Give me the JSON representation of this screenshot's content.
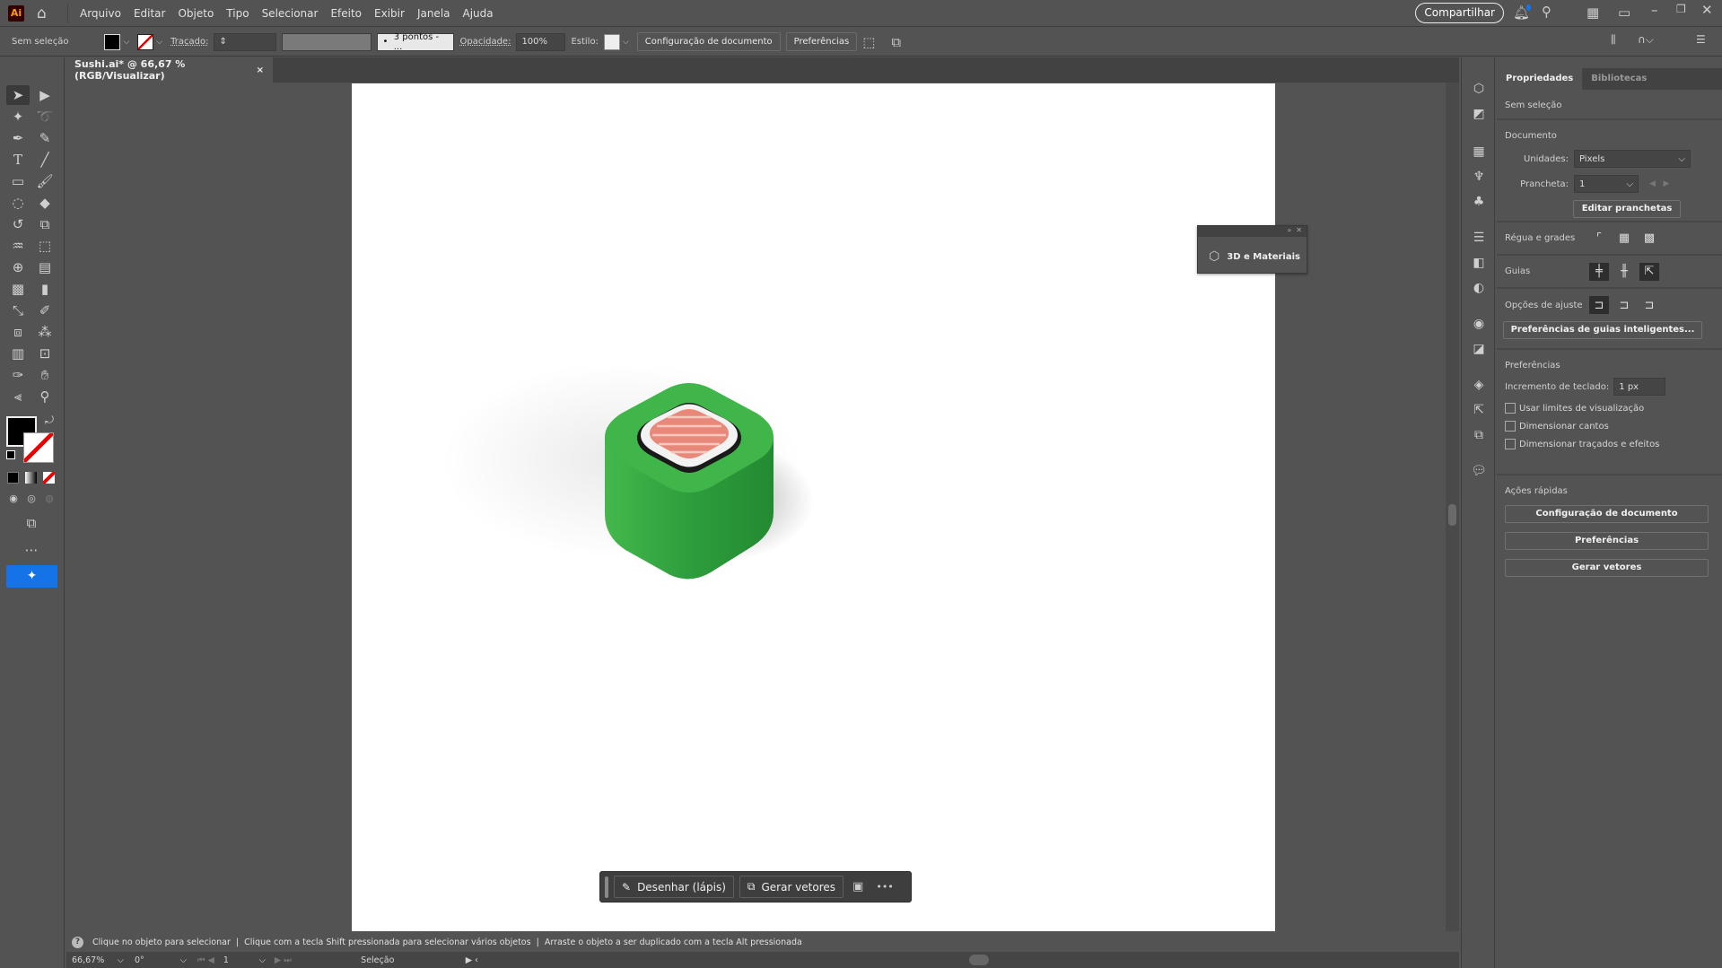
{
  "app": {
    "logo": "Ai",
    "menus": [
      "Arquivo",
      "Editar",
      "Objeto",
      "Tipo",
      "Selecionar",
      "Efeito",
      "Exibir",
      "Janela",
      "Ajuda"
    ],
    "share": "Compartilhar"
  },
  "control": {
    "selection": "Sem seleção",
    "stroke_label": "Traçado:",
    "brush": "3 pontos - ...",
    "opacity_label": "Opacidade:",
    "opacity": "100%",
    "style_label": "Estilo:",
    "doc_setup": "Configuração de documento",
    "prefs": "Preferências"
  },
  "tab": {
    "title": "Sushi.ai* @ 66,67 % (RGB/Visualizar)",
    "close": "×"
  },
  "panel3d": {
    "title": "3D e Materiais"
  },
  "floatbar": {
    "draw": "Desenhar (lápis)",
    "generate": "Gerar vetores",
    "more": "•••"
  },
  "right": {
    "tabs": [
      "Propriedades",
      "Bibliotecas"
    ],
    "selection": "Sem seleção",
    "document": "Documento",
    "units_label": "Unidades:",
    "units": "Pixels",
    "artboard_label": "Prancheta:",
    "artboard": "1",
    "edit_artboards": "Editar pranchetas",
    "rulers": "Régua e grades",
    "guides": "Guias",
    "snap": "Opções de ajuste",
    "smart_guides": "Preferências de guias inteligentes...",
    "prefs_title": "Preferências",
    "keyboard_inc_label": "Incremento de teclado:",
    "keyboard_inc": "1 px",
    "checks": [
      "Usar limites de visualização",
      "Dimensionar cantos",
      "Dimensionar traçados e efeitos"
    ],
    "quick": "Ações rápidas",
    "quick_buttons": [
      "Configuração de documento",
      "Preferências",
      "Gerar vetores"
    ]
  },
  "status": {
    "hint": "Clique no objeto para selecionar  |  Clique com a tecla Shift pressionada para selecionar vários objetos  |  Arraste o objeto a ser duplicado com a tecla Alt pressionada",
    "zoom": "66,67%",
    "rotation": "0°",
    "artboard": "1",
    "tool": "Seleção"
  },
  "colors": {
    "accent": "#1473e6",
    "green": "#3cb04a",
    "salmon": "#e8887a"
  }
}
